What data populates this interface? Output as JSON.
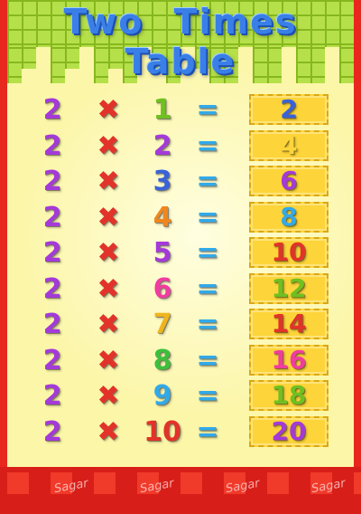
{
  "title": "Two Times Table",
  "rows": [
    {
      "a": "2",
      "op": "✖",
      "b": "1",
      "eq": "=",
      "ans": "2",
      "b_color": "#6fc022",
      "ans_color": "#3a62d8"
    },
    {
      "a": "2",
      "op": "✖",
      "b": "2",
      "eq": "=",
      "ans": "4",
      "b_color": "#a43ad9",
      "ans_color": "#fdd53a"
    },
    {
      "a": "2",
      "op": "✖",
      "b": "3",
      "eq": "=",
      "ans": "6",
      "b_color": "#3a62d8",
      "ans_color": "#a43ad9"
    },
    {
      "a": "2",
      "op": "✖",
      "b": "4",
      "eq": "=",
      "ans": "8",
      "b_color": "#f0861e",
      "ans_color": "#33a9e8"
    },
    {
      "a": "2",
      "op": "✖",
      "b": "5",
      "eq": "=",
      "ans": "10",
      "b_color": "#a43ad9",
      "ans_color": "#e2332a"
    },
    {
      "a": "2",
      "op": "✖",
      "b": "6",
      "eq": "=",
      "ans": "12",
      "b_color": "#f03ca0",
      "ans_color": "#6fc022"
    },
    {
      "a": "2",
      "op": "✖",
      "b": "7",
      "eq": "=",
      "ans": "14",
      "b_color": "#f0b41e",
      "ans_color": "#e2332a"
    },
    {
      "a": "2",
      "op": "✖",
      "b": "8",
      "eq": "=",
      "ans": "16",
      "b_color": "#3dbf3d",
      "ans_color": "#f03ca0"
    },
    {
      "a": "2",
      "op": "✖",
      "b": "9",
      "eq": "=",
      "ans": "18",
      "b_color": "#33a9e8",
      "ans_color": "#6fc022"
    },
    {
      "a": "2",
      "op": "✖",
      "b": "10",
      "eq": "=",
      "ans": "20",
      "b_color": "#e2332a",
      "ans_color": "#a43ad9"
    }
  ],
  "watermark": "Sagar",
  "colors": {
    "background": "#fcf6a8",
    "header_green": "#b6e04a",
    "border_red": "#e8281e",
    "answer_box": "#fdd53a"
  }
}
